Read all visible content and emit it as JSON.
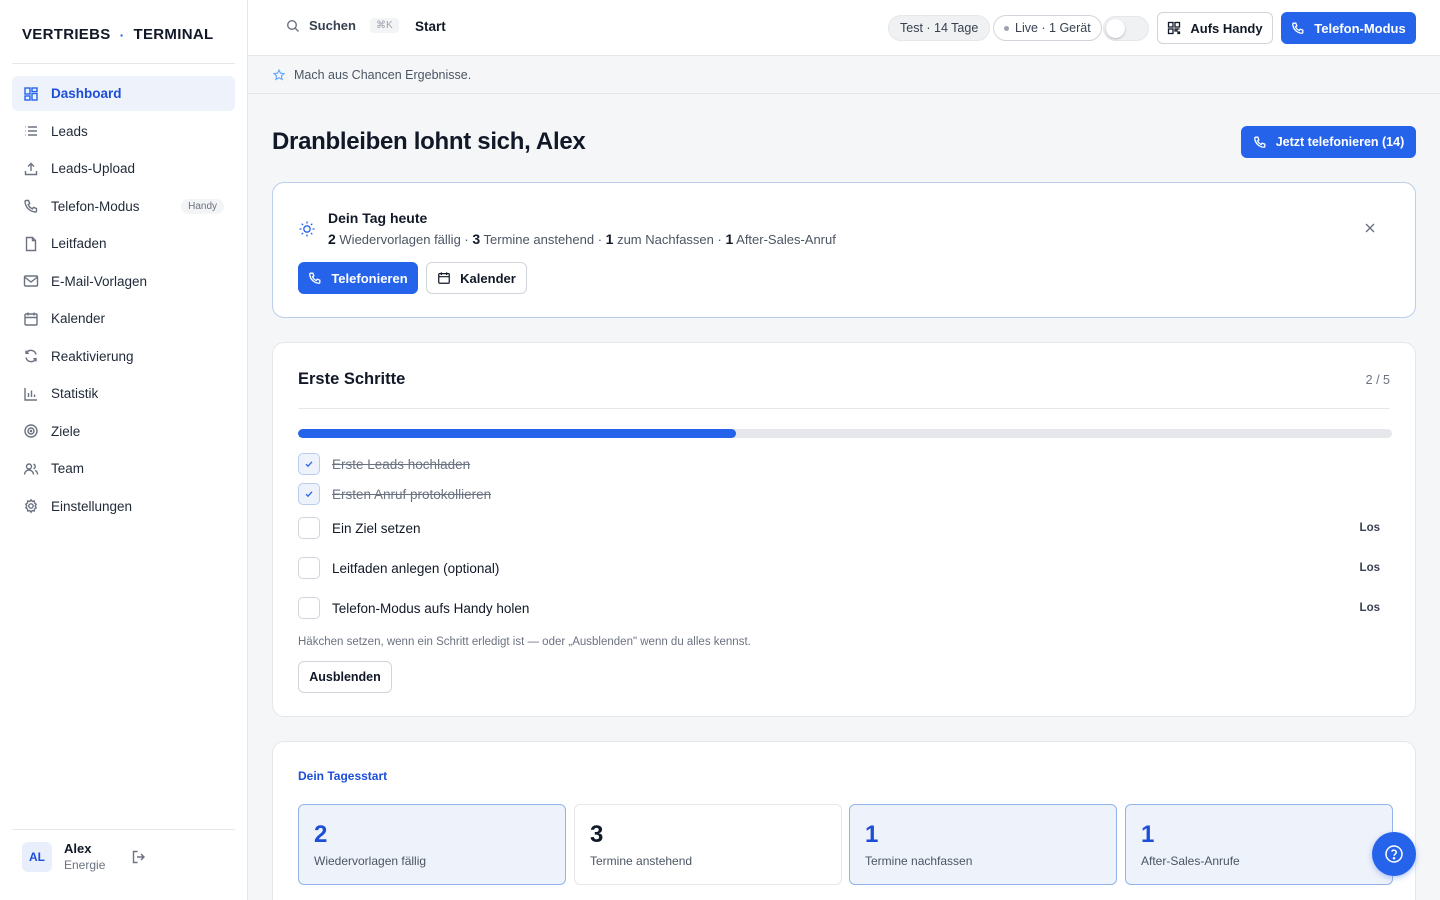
{
  "brand": {
    "left": "VERTRIEBS",
    "dot": "·",
    "right": "TERMINAL"
  },
  "sidebar": {
    "items": [
      {
        "label": "Dashboard",
        "icon": "dashboard-icon",
        "active": true
      },
      {
        "label": "Leads",
        "icon": "list-icon"
      },
      {
        "label": "Leads-Upload",
        "icon": "upload-icon"
      },
      {
        "label": "Telefon-Modus",
        "icon": "phone-icon",
        "badge": "Handy"
      },
      {
        "label": "Leitfaden",
        "icon": "document-icon"
      },
      {
        "label": "E-Mail-Vorlagen",
        "icon": "mail-icon"
      },
      {
        "label": "Kalender",
        "icon": "calendar-icon"
      },
      {
        "label": "Reaktivierung",
        "icon": "refresh-icon"
      },
      {
        "label": "Statistik",
        "icon": "bar-chart-icon"
      },
      {
        "label": "Ziele",
        "icon": "target-icon"
      },
      {
        "label": "Team",
        "icon": "users-icon"
      },
      {
        "label": "Einstellungen",
        "icon": "gear-icon"
      }
    ],
    "user": {
      "initials": "AL",
      "name": "Alex",
      "role": "Energie"
    }
  },
  "topbar": {
    "search_label": "Suchen",
    "search_shortcut": "⌘K",
    "breadcrumb": "Start",
    "trial_pill": "Test · 14 Tage",
    "live_pill": "Live · 1 Gerät",
    "handy_button": "Aufs Handy",
    "phone_mode_button": "Telefon-Modus"
  },
  "motto": "Mach aus Chancen Ergebnisse.",
  "main": {
    "title": "Dranbleiben lohnt sich, Alex",
    "call_now_button": "Jetzt telefonieren (14)"
  },
  "day_card": {
    "title": "Dein Tag heute",
    "summary": [
      {
        "num": "2",
        "text": " Wiedervorlagen fällig · "
      },
      {
        "num": "3",
        "text": " Termine anstehend · "
      },
      {
        "num": "1",
        "text": " zum Nachfassen · "
      },
      {
        "num": "1",
        "text": " After-Sales-Anruf"
      }
    ],
    "call_button": "Telefonieren",
    "calendar_button": "Kalender"
  },
  "steps_card": {
    "title": "Erste Schritte",
    "count": "2 / 5",
    "progress": 0.4,
    "steps": [
      {
        "label": "Erste Leads hochladen",
        "done": true
      },
      {
        "label": "Ersten Anruf protokollieren",
        "done": true
      },
      {
        "label": "Ein Ziel setzen",
        "done": false,
        "action": "Los"
      },
      {
        "label": "Leitfaden anlegen (optional)",
        "done": false,
        "action": "Los"
      },
      {
        "label": "Telefon-Modus aufs Handy holen",
        "done": false,
        "action": "Los"
      }
    ],
    "hint": "Häkchen setzen, wenn ein Schritt erledigt ist — oder „Ausblenden\" wenn du alles kennst.",
    "hide_button": "Ausblenden"
  },
  "start_card": {
    "title": "Dein Tagesstart",
    "stats": [
      {
        "num": "2",
        "label": "Wiedervorlagen fällig",
        "highlight": true
      },
      {
        "num": "3",
        "label": "Termine anstehend",
        "highlight": false
      },
      {
        "num": "1",
        "label": "Termine nachfassen",
        "highlight": true
      },
      {
        "num": "1",
        "label": "After-Sales-Anrufe",
        "highlight": true
      }
    ]
  },
  "colors": {
    "accent": "#2563eb",
    "accent_soft": "#eef2fb",
    "border": "#e5e7eb"
  }
}
